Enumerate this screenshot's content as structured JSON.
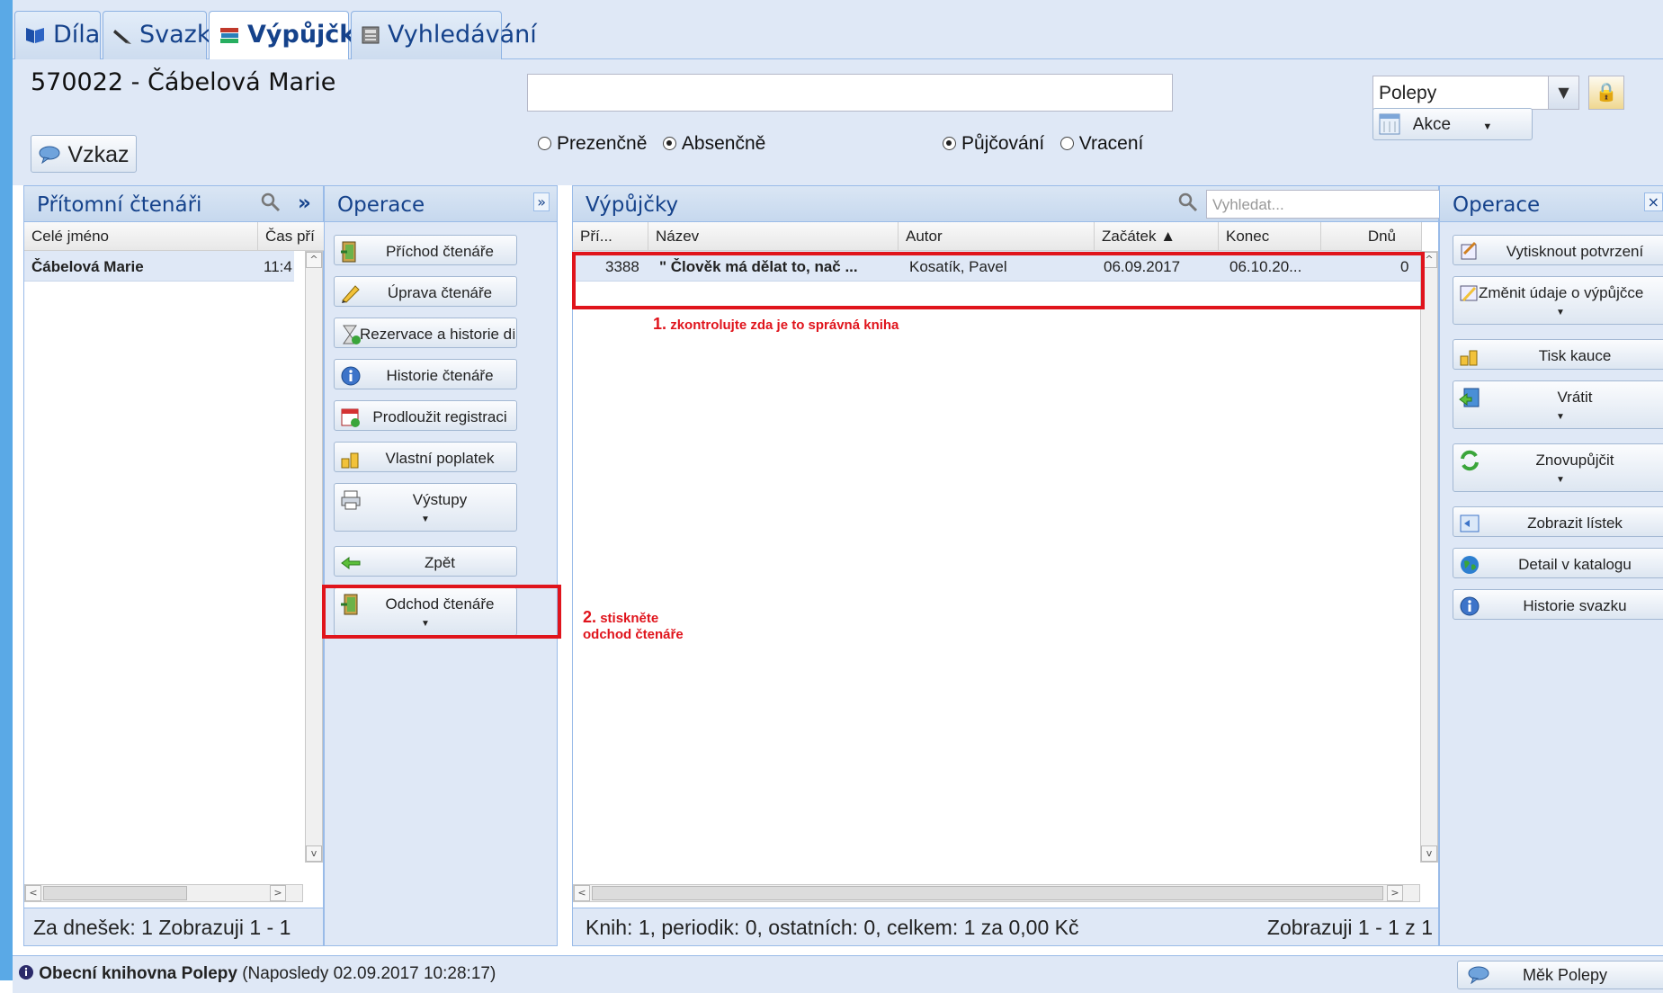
{
  "tabs": [
    {
      "label": "Díla",
      "icon": "book-icon"
    },
    {
      "label": "Svazky",
      "icon": "pen-icon"
    },
    {
      "label": "Výpůjčky",
      "icon": "books-icon"
    },
    {
      "label": "Vyhledávání",
      "icon": "catalog-icon"
    }
  ],
  "header": {
    "reader_title": "570022 - Čábelová Marie",
    "vzkaz_label": "Vzkaz",
    "search_value": "",
    "radio_prezencne": "Prezenčně",
    "radio_absencne": "Absenčně",
    "radio_pujcovani": "Půjčování",
    "radio_vraceni": "Vracení",
    "combo_value": "Polepy",
    "akce_label": "Akce"
  },
  "present_readers": {
    "title": "Přítomní čtenáři",
    "col_name": "Celé jméno",
    "col_time": "Čas pří",
    "rows": [
      {
        "name": "Čábelová Marie",
        "time": "11:4"
      }
    ],
    "footer": "Za dnešek: 1 Zobrazuji 1 - 1"
  },
  "operations_left": {
    "title": "Operace",
    "buttons": [
      "Příchod čtenáře",
      "Úprava čtenáře",
      "Rezervace a historie díla",
      "Historie čtenáře",
      "Prodloužit registraci",
      "Vlastní poplatek",
      "Výstupy",
      "Zpět",
      "Odchod čtenáře"
    ]
  },
  "loans": {
    "title": "Výpůjčky",
    "search_placeholder": "Vyhledat...",
    "columns": [
      "Pří...",
      "Název",
      "Autor",
      "Začátek ▲",
      "Konec",
      "Dnů"
    ],
    "rows": [
      {
        "id": "3388",
        "title": "\" Člověk má dělat to, nač ...",
        "author": "Kosatík, Pavel",
        "start": "06.09.2017",
        "end": "06.10.20...",
        "days": "0"
      }
    ],
    "footer_left": "Knih: 1, periodik: 0, ostatních: 0, celkem: 1 za 0,00 Kč",
    "footer_right": "Zobrazuji 1 - 1 z 1"
  },
  "operations_right": {
    "title": "Operace",
    "buttons": [
      "Vytisknout potvrzení",
      "Změnit údaje o výpůjčce",
      "Tisk kauce",
      "Vrátit",
      "Znovupůjčit",
      "Zobrazit lístek",
      "Detail v katalogu",
      "Historie svazku"
    ]
  },
  "annotations": {
    "note1_num": "1.",
    "note1_text": "zkontrolujte zda je to správná kniha",
    "note2_num": "2.",
    "note2_line1": "stiskněte",
    "note2_line2": "odchod čtenáře"
  },
  "status": {
    "library": "Obecní knihovna Polepy",
    "last": "(Naposledy 02.09.2017 10:28:17)",
    "mek_label": "Měk Polepy"
  },
  "colors": {
    "accent": "#15428b",
    "panel_bg": "#dfe8f6",
    "annotation": "#e0141c"
  }
}
